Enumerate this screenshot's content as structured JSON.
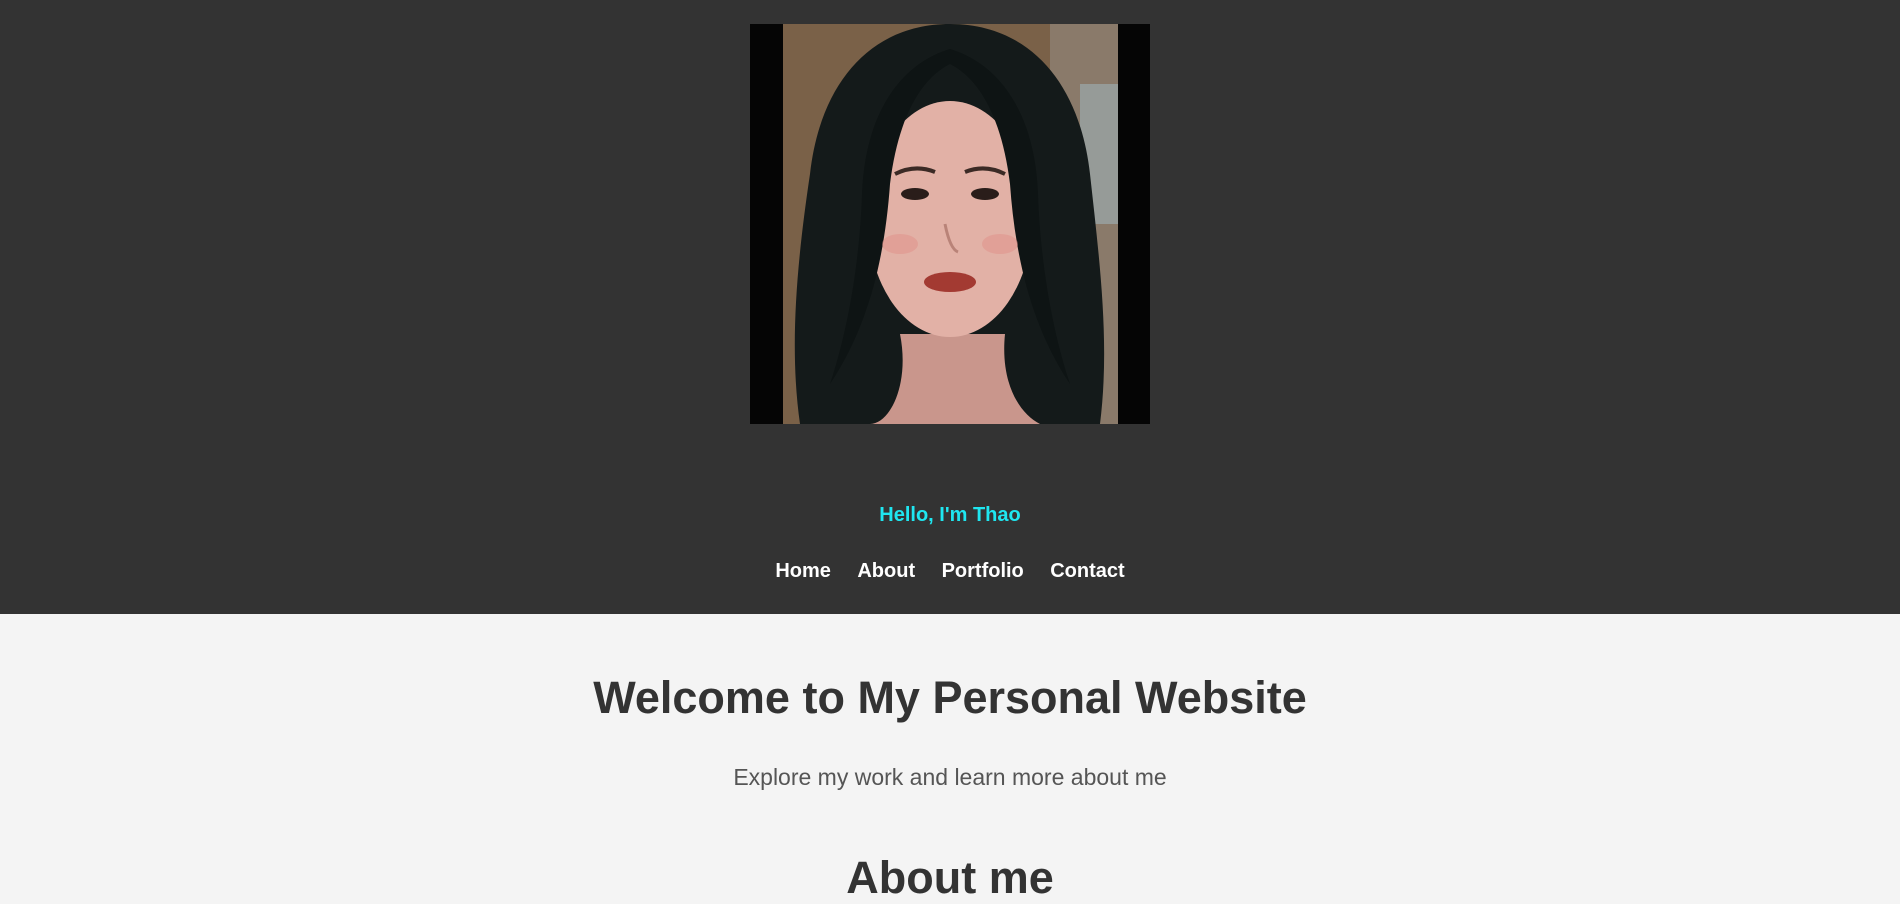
{
  "header": {
    "profile_photo": {
      "icon": "portrait-photo"
    },
    "greeting": "Hello, I'm Thao",
    "nav": [
      "Home",
      "About",
      "Portfolio",
      "Contact"
    ]
  },
  "main": {
    "welcome_title": "Welcome to My Personal Website",
    "tagline": "Explore my work and learn more about me",
    "about_heading": "About me"
  },
  "colors": {
    "header_bg": "#333333",
    "page_bg": "#f4f4f4",
    "greeting": "#1fe6f0",
    "nav_text": "#ffffff",
    "heading_text": "#333333"
  }
}
